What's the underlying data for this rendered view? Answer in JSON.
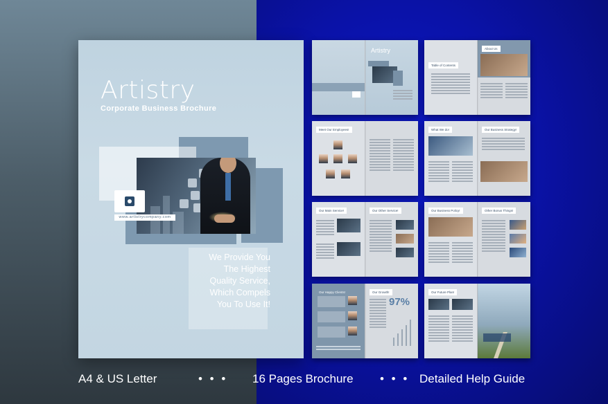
{
  "cover": {
    "title": "Artistry",
    "subtitle": "Corporate Business Brochure",
    "url": "www.artistrycompany.com",
    "tagline": [
      "We Provide You",
      "The Highest",
      "Quality Service,",
      "Which Compels",
      "You To Use It!"
    ]
  },
  "spreads": [
    {
      "left_header": "",
      "right_title": "Artistry",
      "right_header": ""
    },
    {
      "left_header": "Table of Contents",
      "right_header": "About Us"
    },
    {
      "left_header": "Meet Our Employees!",
      "right_header": ""
    },
    {
      "left_header": "What We do!",
      "right_header": "Our Business Strategy!"
    },
    {
      "left_header": "Our Main Service!",
      "right_header": "Our Other Service!"
    },
    {
      "left_header": "Our Business Policy!",
      "right_header": "Other Bonus Things!"
    },
    {
      "left_header": "Our Happy Clients!",
      "right_header": "Our Growth!",
      "growth_value": "97%"
    },
    {
      "left_header": "Our Future Plan!",
      "right_header": ""
    }
  ],
  "footer": {
    "item1": "A4 & US Letter",
    "dots": "• • •",
    "item2": "16 Pages Brochure",
    "item3": "Detailed Help Guide"
  },
  "colors": {
    "left_background": "#5d7381",
    "right_background": "#0a12a8",
    "cover_background": "#c3d6e2",
    "accent_block": "#7e99b0"
  }
}
